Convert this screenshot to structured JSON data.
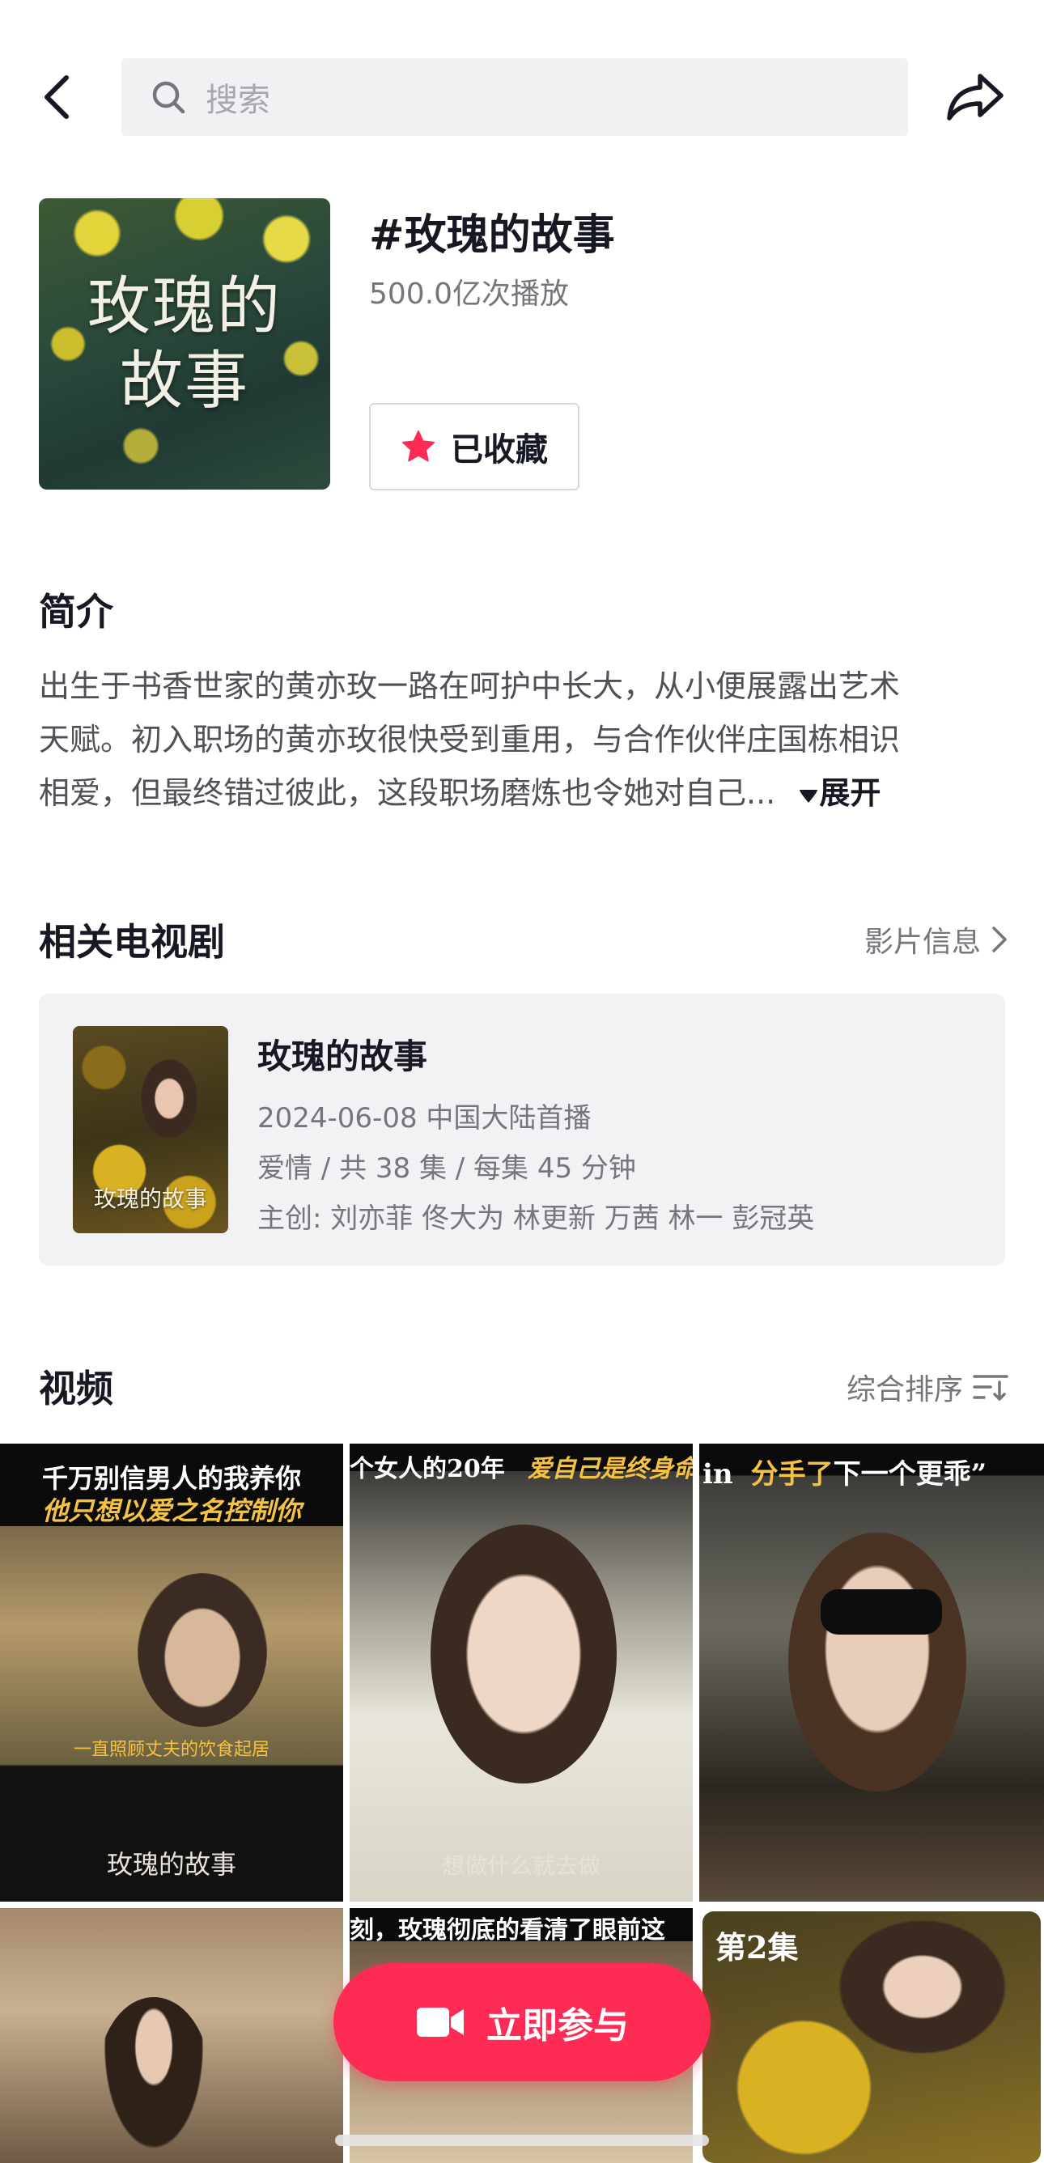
{
  "search": {
    "placeholder": "搜索"
  },
  "topic": {
    "cover_text_line1": "玫瑰的",
    "cover_text_line2": "故事",
    "title": "#玫瑰的故事",
    "plays": "500.0亿次播放",
    "favorite_label": "已收藏"
  },
  "intro": {
    "heading": "简介",
    "line1": "出生于书香世家的黄亦玫一路在呵护中长大，从小便展露出艺术",
    "line2": "天赋。初入职场的黄亦玫很快受到重用，与合作伙伴庄国栋相识",
    "line3": "相爱，但最终错过彼此，这段职场磨炼也令她对自己...",
    "expand_label": "展开"
  },
  "related_tv": {
    "heading": "相关电视剧",
    "link_label": "影片信息",
    "poster_text": "玫瑰的故事",
    "name": "玫瑰的故事",
    "premiere": "2024-06-08 中国大陆首播",
    "meta": "爱情 / 共 38 集 / 每集 45 分钟",
    "creators": "主创: 刘亦菲 佟大为 林更新 万茜 林一 彭冠英"
  },
  "videos": {
    "heading": "视频",
    "sort_label": "综合排序",
    "items": [
      {
        "caption_line1": "千万别信男人的我养你",
        "caption_line2": "他只想以爱之名控制你",
        "mid_caption": "一直照顾丈夫的饮食起居",
        "subtitle": "玫瑰的故事"
      },
      {
        "caption_white": "个女人的20年",
        "caption_gold": "爱自己是终身命",
        "subtitle": "想做什么就去做"
      },
      {
        "caption_white_a": "in",
        "caption_gold": "分手了",
        "caption_white_b": "下一个更乖”"
      },
      {},
      {
        "caption": "刻，玫瑰彻底的看清了眼前这"
      },
      {
        "caption": "第2集"
      }
    ]
  },
  "join_button": {
    "label": "立即参与"
  },
  "colors": {
    "accent": "#fe2c55",
    "star": "#fe2c55",
    "caption_gold": "#f5c242"
  }
}
